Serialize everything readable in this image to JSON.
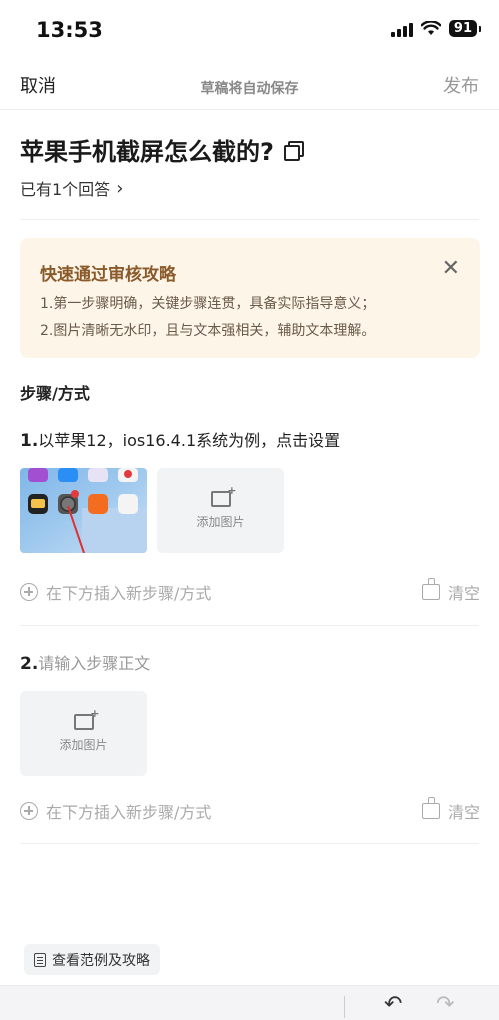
{
  "status_bar": {
    "time": "13:53",
    "battery": "91"
  },
  "nav": {
    "cancel_label": "取消",
    "autosave_hint": "草稿将自动保存",
    "publish_label": "发布"
  },
  "question": {
    "title": "苹果手机截屏怎么截的?",
    "answers_label": "已有1个回答"
  },
  "tips": {
    "title": "快速通过审核攻略",
    "lines": [
      "1.第一步骤明确，关键步骤连贯，具备实际指导意义；",
      "2.图片清晰无水印，且与文本强相关，辅助文本理解。"
    ]
  },
  "section_title": "步骤/方式",
  "steps": [
    {
      "number": "1.",
      "text": "以苹果12，ios16.4.1系统为例，点击设置",
      "add_image_label": "添加图片",
      "insert_label": "在下方插入新步骤/方式",
      "clear_label": "清空"
    },
    {
      "number": "2.",
      "placeholder": "请输入步骤正文",
      "add_image_label": "添加图片",
      "insert_label": "在下方插入新步骤/方式",
      "clear_label": "清空"
    }
  ],
  "examples_button": "查看范例及攻略",
  "colors": {
    "tips_bg": "#fdf5e8",
    "tips_title": "#8a5a2a",
    "muted": "#aaaaaa"
  }
}
